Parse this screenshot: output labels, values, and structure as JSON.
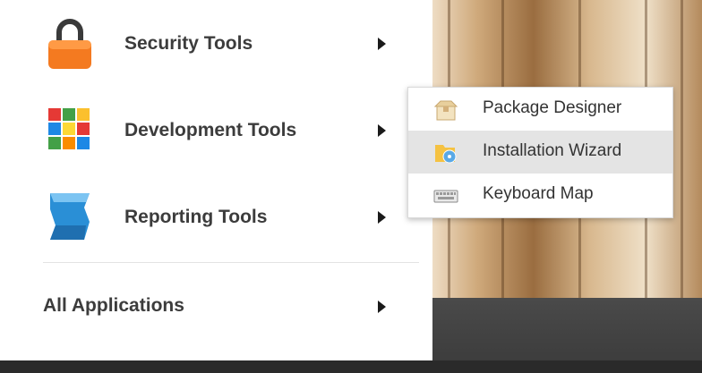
{
  "start_menu": {
    "items": [
      {
        "label": "Security Tools",
        "icon": "lock-icon"
      },
      {
        "label": "Development Tools",
        "icon": "cube-icon"
      },
      {
        "label": "Reporting Tools",
        "icon": "report-stack-icon"
      }
    ],
    "all_apps_label": "All Applications"
  },
  "submenu": {
    "items": [
      {
        "label": "Package Designer",
        "icon": "package-icon"
      },
      {
        "label": "Installation Wizard",
        "icon": "installer-disc-icon",
        "active": true
      },
      {
        "label": "Keyboard Map",
        "icon": "keyboard-icon"
      }
    ]
  },
  "colors": {
    "menu_bg": "#ffffff",
    "hover_bg": "#e4e4e4",
    "text": "#3c3c3c",
    "lock_orange": "#f47a20",
    "report_blue": "#2a8fd6"
  }
}
